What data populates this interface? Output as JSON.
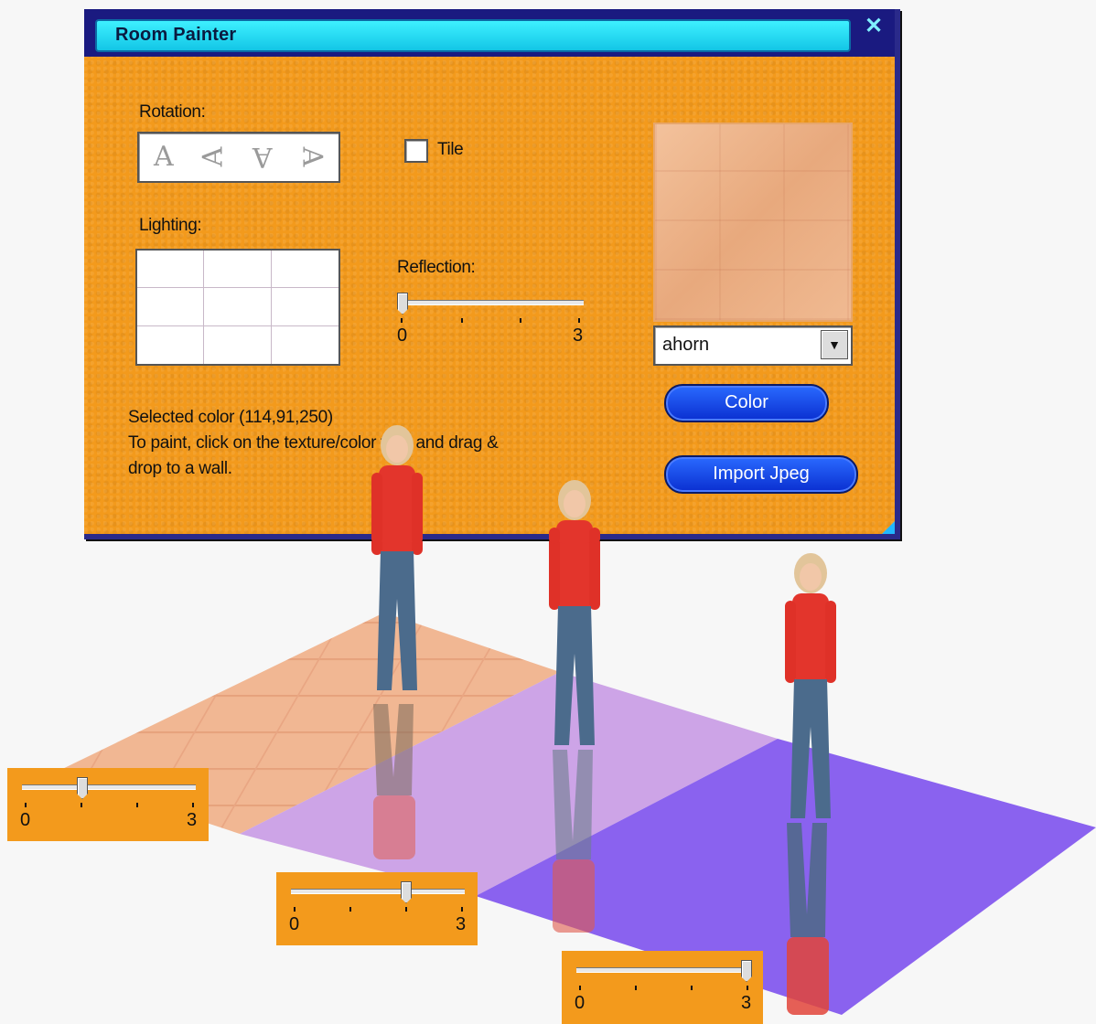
{
  "window": {
    "title": "Room Painter",
    "close_glyph": "✕"
  },
  "rotation": {
    "label": "Rotation:",
    "glyphs": [
      "A",
      "A",
      "A",
      "A"
    ]
  },
  "tile": {
    "label": "Tile",
    "checked": false
  },
  "lighting": {
    "label": "Lighting:"
  },
  "reflection": {
    "label": "Reflection:",
    "min_label": "0",
    "max_label": "3",
    "value": 0
  },
  "texture": {
    "selected": "ahorn",
    "dropdown_arrow": "▼"
  },
  "buttons": {
    "color": "Color",
    "import": "Import Jpeg"
  },
  "status": {
    "line1": "Selected color (114,91,250)",
    "line2": "To paint, click on the texture/color field and  drag &",
    "line3": "drop to a wall."
  },
  "examples": [
    {
      "min_label": "0",
      "max_label": "3",
      "value": 1
    },
    {
      "min_label": "0",
      "max_label": "3",
      "value": 2
    },
    {
      "min_label": "0",
      "max_label": "3",
      "value": 3
    }
  ],
  "colors": {
    "panel": "#f39a1c",
    "title_bar": "#1a1a80",
    "title_fill": "#13c6e6",
    "button": "#1640e6",
    "floor_wood": "#f0b896",
    "floor_light_purple": "#c79be6",
    "floor_purple": "#8a63ee"
  }
}
